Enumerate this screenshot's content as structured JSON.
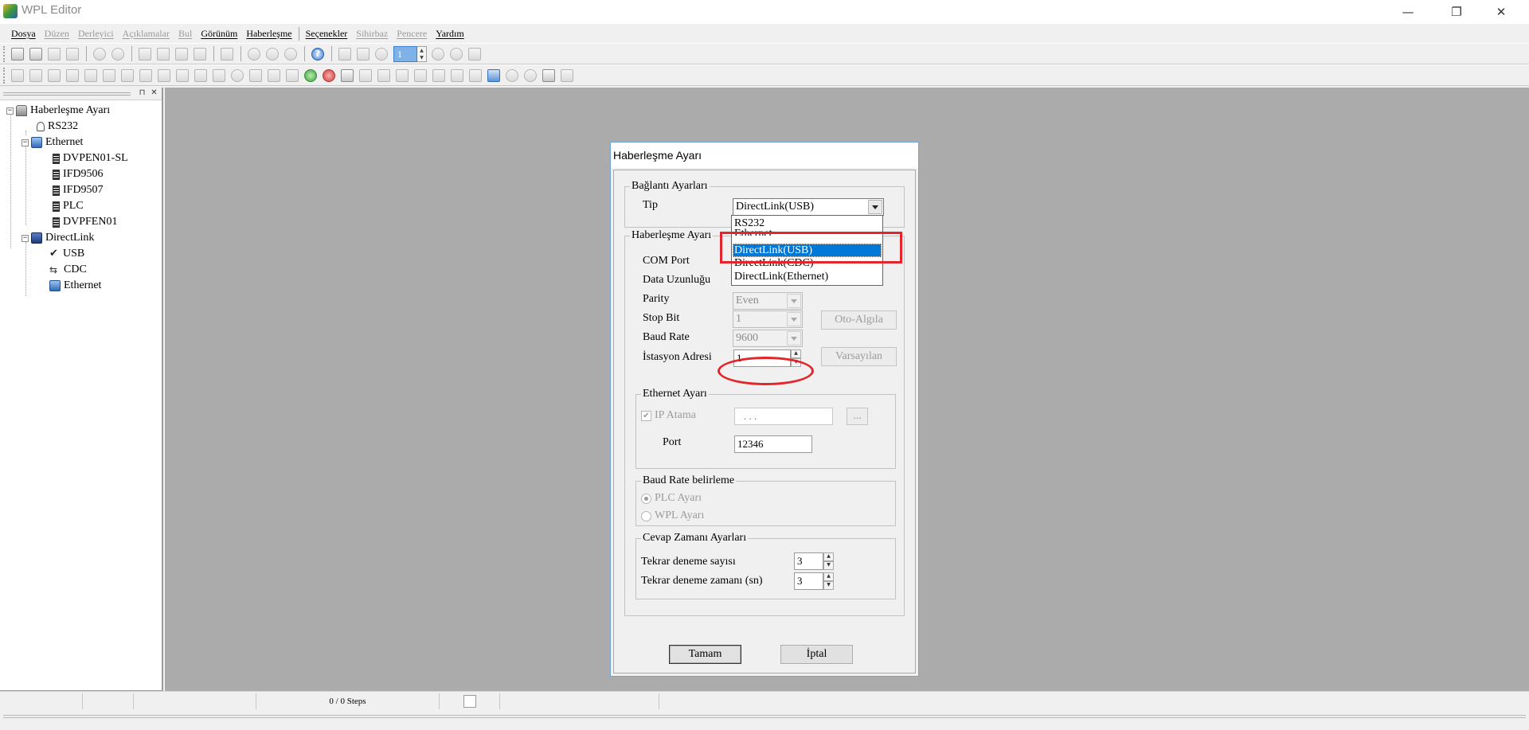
{
  "window": {
    "title": "WPL Editor",
    "minimize": "—",
    "maximize": "❐",
    "close": "✕"
  },
  "menu": [
    {
      "label": "Dosya",
      "enabled": true
    },
    {
      "label": "Düzen",
      "enabled": false
    },
    {
      "label": "Derleyici",
      "enabled": false
    },
    {
      "label": "Açıklamalar",
      "enabled": false
    },
    {
      "label": "Bul",
      "enabled": false
    },
    {
      "label": "Görünüm",
      "enabled": true
    },
    {
      "label": "Haberleşme",
      "enabled": true
    },
    {
      "label": "Seçenekler",
      "enabled": true
    },
    {
      "label": "Sihirbaz",
      "enabled": false
    },
    {
      "label": "Pencere",
      "enabled": false
    },
    {
      "label": "Yardım",
      "enabled": true
    }
  ],
  "toolbar": {
    "step_value": "1",
    "help_glyph": "?"
  },
  "tree": {
    "collapse_glyph": "−",
    "pin": "⊓",
    "close": "✕",
    "root": "Haberleşme Ayarı",
    "rs232": "RS232",
    "ethernet": "Ethernet",
    "ethernet_children": [
      "DVPEN01-SL",
      "IFD9506",
      "IFD9507",
      "PLC",
      "DVPFEN01"
    ],
    "directlink": "DirectLink",
    "check_glyph": "✔",
    "usb_glyph": "⇆",
    "directlink_children": [
      "USB",
      "CDC",
      "Ethernet"
    ]
  },
  "status": {
    "steps": "0 / 0 Steps"
  },
  "dialog": {
    "title": "Haberleşme Ayarı",
    "connection_group": "Bağlantı Ayarları",
    "type_label": "Tip",
    "type_value": "DirectLink(USB)",
    "type_options": [
      "RS232",
      "Ethernet",
      "DirectLink(USB)",
      "DirectLink(CDC)",
      "DirectLink(Ethernet)"
    ],
    "comm_group": "Haberleşme Ayarı",
    "com_port_label": "COM Port",
    "data_length_label": "Data Uzunluğu",
    "parity_label": "Parity",
    "parity_value": "Even",
    "stop_bit_label": "Stop Bit",
    "stop_bit_value": "1",
    "baud_rate_label": "Baud Rate",
    "baud_rate_value": "9600",
    "station_label": "İstasyon Adresi",
    "station_value": "1",
    "auto_detect_button": "Oto-Algıla",
    "defaults_button": "Varsayılan",
    "ethernet_group": "Ethernet Ayarı",
    "ip_check_glyph": "✔",
    "ip_label": "IP Atama",
    "ip_value": ". . .",
    "ip_browse": "...",
    "port_label": "Port",
    "port_value": "12346",
    "baud_group": "Baud Rate belirleme",
    "plc_setting": "PLC Ayarı",
    "wpl_setting": "WPL Ayarı",
    "response_group": "Cevap Zamanı Ayarları",
    "retry_count_label": "Tekrar deneme sayısı",
    "retry_count_value": "3",
    "retry_time_label": "Tekrar deneme zamanı (sn)",
    "retry_time_value": "3",
    "ok_button": "Tamam",
    "cancel_button": "İptal",
    "spin_up": "▲",
    "spin_down": "▼"
  },
  "annotation_color": "#e2262b",
  "selection_color": "#0078d7"
}
